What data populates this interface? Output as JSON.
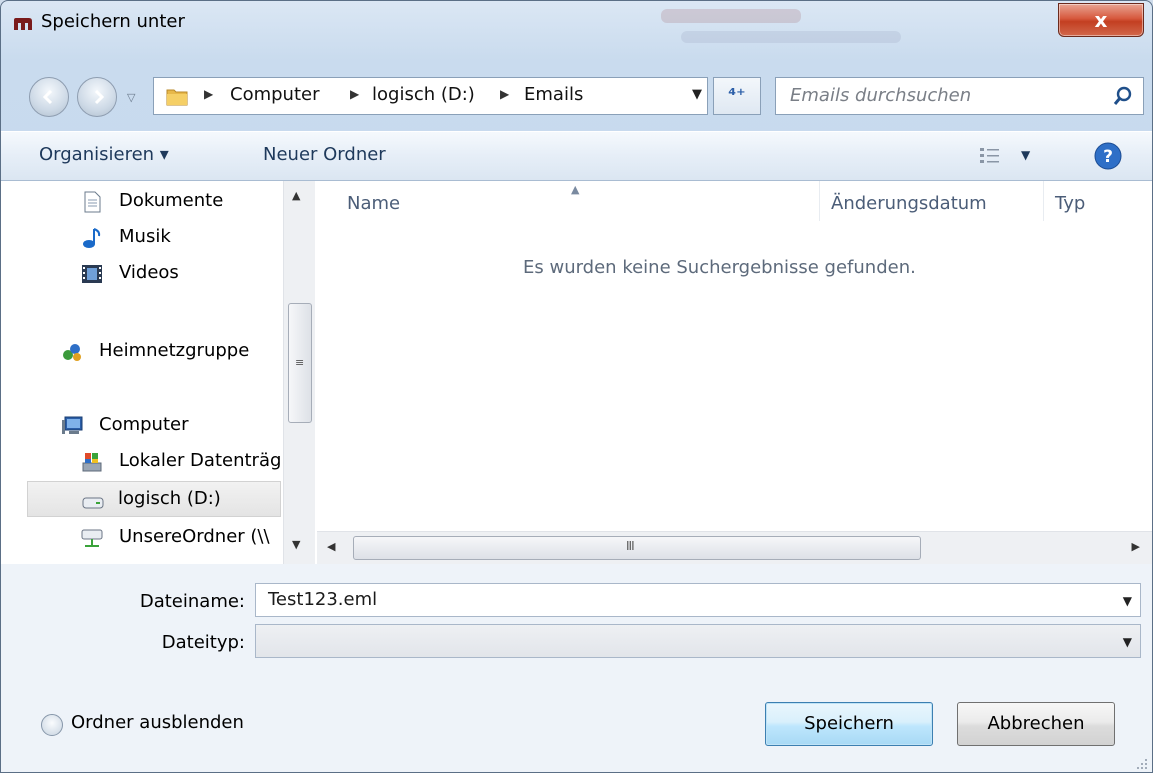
{
  "window": {
    "title": "Speichern unter",
    "close_label": "x"
  },
  "nav": {
    "breadcrumb": [
      "Computer",
      "logisch (D:)",
      "Emails"
    ],
    "search_placeholder": "Emails durchsuchen"
  },
  "toolbar": {
    "organize_label": "Organisieren ▾",
    "new_folder_label": "Neuer Ordner"
  },
  "sidebar": {
    "items": [
      {
        "label": "Dokumente",
        "icon": "documents-icon"
      },
      {
        "label": "Musik",
        "icon": "music-icon"
      },
      {
        "label": "Videos",
        "icon": "videos-icon"
      },
      {
        "label": "Heimnetzgruppe",
        "icon": "homegroup-icon"
      },
      {
        "label": "Computer",
        "icon": "computer-icon"
      },
      {
        "label": "Lokaler Datenträg",
        "icon": "local-disk-icon"
      },
      {
        "label": "logisch (D:)",
        "icon": "drive-icon",
        "selected": true
      },
      {
        "label": "UnsereOrdner (\\\\",
        "icon": "network-drive-icon"
      }
    ]
  },
  "files": {
    "columns": [
      "Name",
      "Änderungsdatum",
      "Typ"
    ],
    "empty_message": "Es wurden keine Suchergebnisse gefunden.",
    "hscroll_grip": "III"
  },
  "form": {
    "filename_label": "Dateiname:",
    "filename_value": "Test123.eml",
    "filetype_label": "Dateityp:",
    "filetype_value": "",
    "hide_folders_label": "Ordner ausblenden",
    "save_label": "Speichern",
    "cancel_label": "Abbrechen"
  }
}
